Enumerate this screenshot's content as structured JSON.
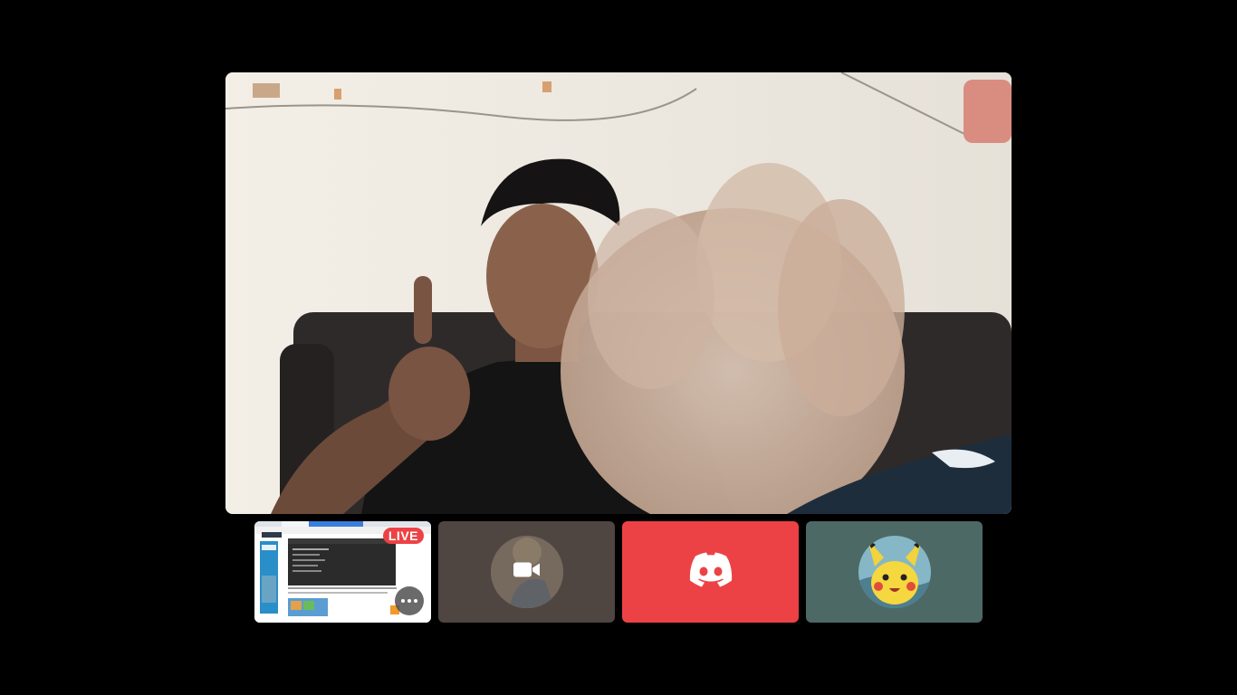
{
  "colors": {
    "background": "#000000",
    "discord_red": "#ED4245",
    "tile_brown": "#4f4541",
    "tile_slate": "#4d6966",
    "live_badge": "#ED4245"
  },
  "main_video": {
    "icon": "participant-video-feed"
  },
  "tiles": [
    {
      "type": "screen-share",
      "badge": "LIVE",
      "menu_icon": "more-options-icon"
    },
    {
      "type": "camera-off",
      "icon": "video-camera-icon"
    },
    {
      "type": "discord-logo",
      "icon": "discord-icon"
    },
    {
      "type": "avatar",
      "icon": "pikachu-avatar"
    }
  ]
}
